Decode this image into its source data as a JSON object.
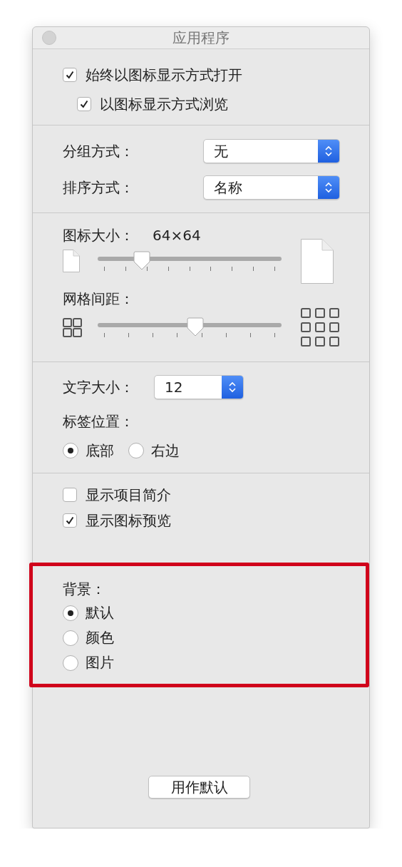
{
  "window": {
    "title": "应用程序"
  },
  "sections": [
    {
      "rows": [
        {
          "kind": "checkbox",
          "label": "始终以图标显示方式打开",
          "checked": true,
          "children": [
            {
              "kind": "checkbox",
              "label": "以图标显示方式浏览",
              "checked": true
            }
          ]
        }
      ]
    },
    {
      "rows": [
        {
          "kind": "popup",
          "label": "分组方式：",
          "value": "无"
        },
        {
          "kind": "popup",
          "label": "排序方式：",
          "value": "名称"
        }
      ]
    },
    {
      "rows": [
        {
          "kind": "sizeslider",
          "label": "图标大小：",
          "reading": "64×64",
          "level": 0.24
        },
        {
          "kind": "spacingslider",
          "label": "网格间距：",
          "level": 0.53
        }
      ]
    },
    {
      "rows": [
        {
          "kind": "inlinepopup",
          "label": "文字大小：",
          "value": "12"
        },
        {
          "kind": "heading",
          "label": "标签位置："
        },
        {
          "kind": "radiorow",
          "options": [
            {
              "label": "底部",
              "selected": true
            },
            {
              "label": "右边",
              "selected": false
            }
          ]
        }
      ]
    },
    {
      "rows": [
        {
          "kind": "checkbox",
          "label": "显示项目简介",
          "checked": false
        },
        {
          "kind": "checkbox",
          "label": "显示图标预览",
          "checked": true
        }
      ]
    },
    {
      "highlighted": true,
      "rows": [
        {
          "kind": "heading",
          "label": "背景："
        },
        {
          "kind": "radiolist",
          "options": [
            {
              "label": "默认",
              "selected": true
            },
            {
              "label": "颜色",
              "selected": false
            },
            {
              "label": "图片",
              "selected": false
            }
          ]
        }
      ]
    }
  ],
  "footer": {
    "button": "用作默认"
  }
}
